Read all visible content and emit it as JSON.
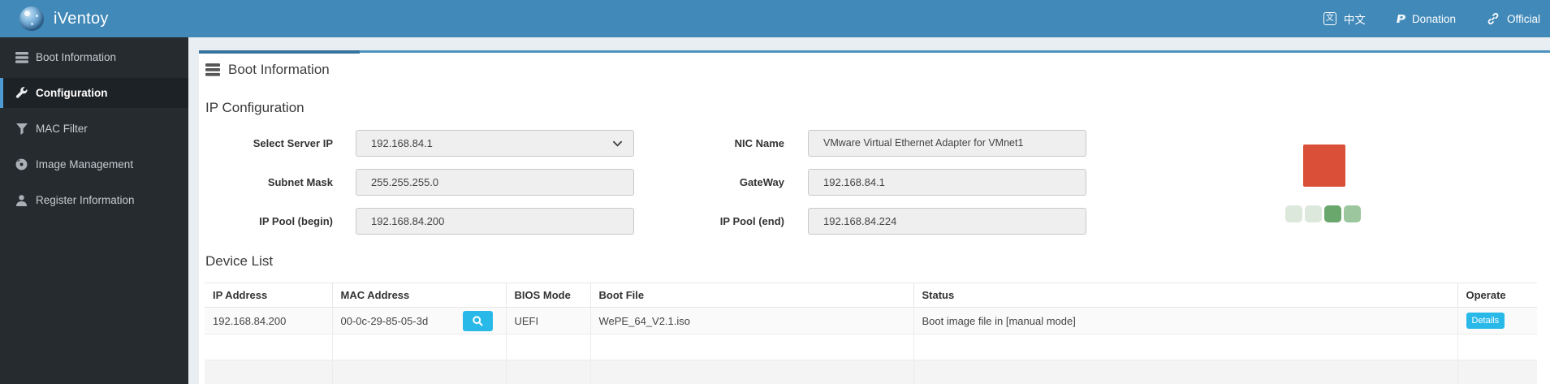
{
  "header": {
    "brand": "iVentoy",
    "links": {
      "language": "中文",
      "donation": "Donation",
      "official": "Official"
    }
  },
  "sidebar": {
    "items": [
      {
        "label": "Boot Information",
        "icon": "server-stack-icon",
        "active": false
      },
      {
        "label": "Configuration",
        "icon": "wrench-icon",
        "active": true
      },
      {
        "label": "MAC Filter",
        "icon": "filter-icon",
        "active": false
      },
      {
        "label": "Image Management",
        "icon": "disc-icon",
        "active": false
      },
      {
        "label": "Register Information",
        "icon": "user-icon",
        "active": false
      }
    ]
  },
  "main": {
    "panel_title": "Boot Information",
    "ip_configuration": {
      "title": "IP Configuration",
      "rows": [
        {
          "left": {
            "label": "Select Server IP",
            "value": "192.168.84.1"
          },
          "right": {
            "label": "NIC Name",
            "value": "VMware Virtual Ethernet Adapter for VMnet1"
          }
        },
        {
          "left": {
            "label": "Subnet Mask",
            "value": "255.255.255.0"
          },
          "right": {
            "label": "GateWay",
            "value": "192.168.84.1"
          }
        },
        {
          "left": {
            "label": "IP Pool (begin)",
            "value": "192.168.84.200"
          },
          "right": {
            "label": "IP Pool (end)",
            "value": "192.168.84.224"
          }
        }
      ]
    },
    "status_widget": {
      "stop_button_color": "#d94f37",
      "cell_colors": [
        "#dde8dd",
        "#dde8dd",
        "#69a76c",
        "#9cc79e"
      ]
    },
    "device_list": {
      "title": "Device List",
      "columns": [
        "IP Address",
        "MAC Address",
        "BIOS Mode",
        "Boot File",
        "Status",
        "Operate"
      ],
      "rows": [
        {
          "ip": "192.168.84.200",
          "mac": "00-0c-29-85-05-3d",
          "bios_mode": "UEFI",
          "boot_file": "WePE_64_V2.1.iso",
          "status": "Boot image file in [manual mode]",
          "operate_label": "Details"
        }
      ]
    }
  }
}
